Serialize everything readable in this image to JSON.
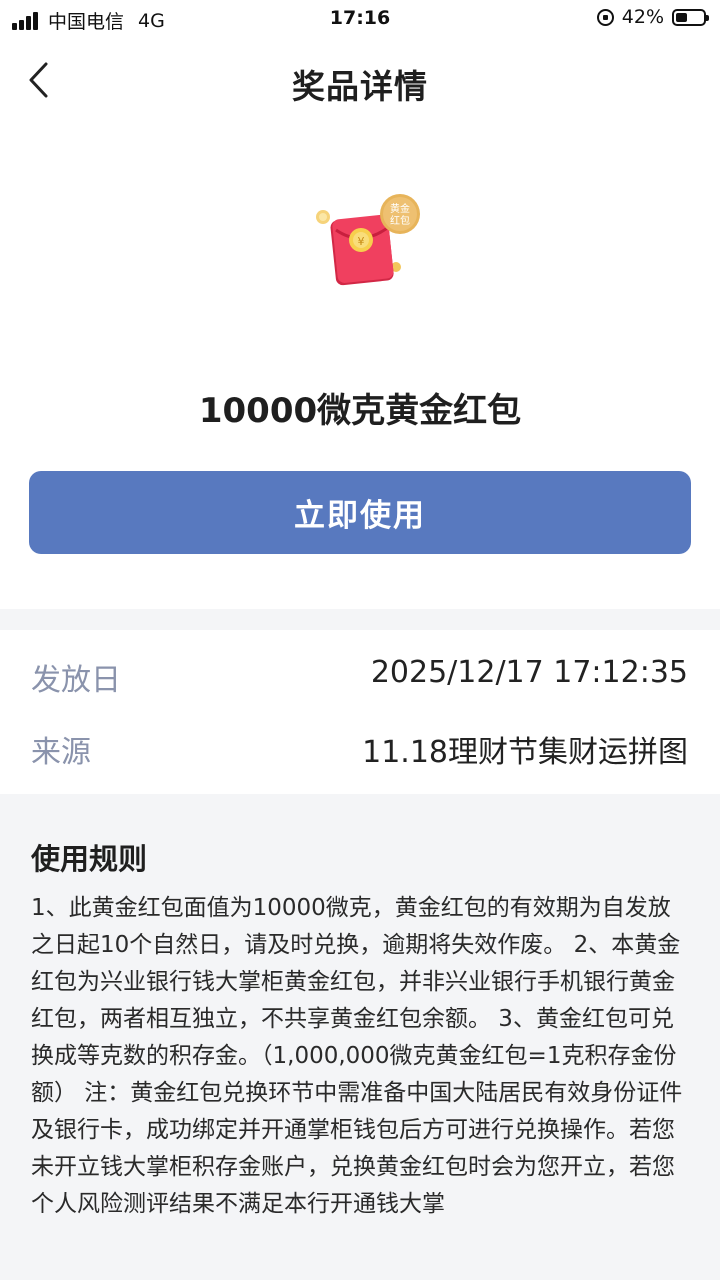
{
  "status_bar": {
    "carrier": "中国电信",
    "network": "4G",
    "time": "17:16",
    "battery_percent": "42%",
    "battery_level": 0.42
  },
  "nav": {
    "title": "奖品详情",
    "back_icon": "chevron-left-icon"
  },
  "prize": {
    "image_icon": "gold-red-envelope-icon",
    "badge_line1": "黄金",
    "badge_line2": "红包",
    "name": "10000微克黄金红包",
    "button_label": "立即使用",
    "button_color": "#5879bf"
  },
  "info": {
    "issue_date_label": "发放日",
    "issue_date_value": "2025/12/17 17:12:35",
    "source_label": "来源",
    "source_value": "11.18理财节集财运拼图"
  },
  "rules": {
    "title": "使用规则",
    "text": "1、此黄金红包面值为10000微克，黄金红包的有效期为自发放之日起10个自然日，请及时兑换，逾期将失效作废。 2、本黄金红包为兴业银行钱大掌柜黄金红包，并非兴业银行手机银行黄金红包，两者相互独立，不共享黄金红包余额。 3、黄金红包可兑换成等克数的积存金。（1,000,000微克黄金红包=1克积存金份额） 注：黄金红包兑换环节中需准备中国大陆居民有效身份证件及银行卡，成功绑定并开通掌柜钱包后方可进行兑换操作。若您未开立钱大掌柜积存金账户，兑换黄金红包时会为您开立，若您个人风险测评结果不满足本行开通钱大掌"
  }
}
